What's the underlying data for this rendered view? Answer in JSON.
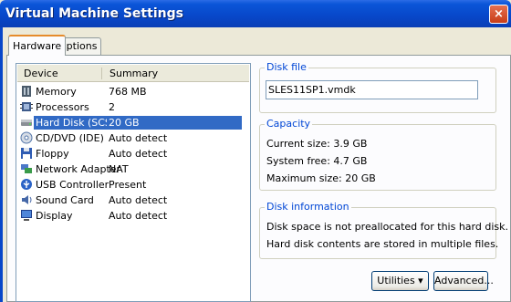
{
  "window": {
    "title": "Virtual Machine Settings",
    "close_glyph": "×"
  },
  "tabs": [
    {
      "label": "Hardware"
    },
    {
      "label": "Options"
    }
  ],
  "device_list": {
    "columns": {
      "device": "Device",
      "summary": "Summary"
    },
    "rows": [
      {
        "name": "Memory",
        "summary": "768 MB",
        "icon": "memory-icon"
      },
      {
        "name": "Processors",
        "summary": "2",
        "icon": "processor-icon"
      },
      {
        "name": "Hard Disk (SCSI)",
        "summary": "20 GB",
        "icon": "hard-disk-icon",
        "selected": true
      },
      {
        "name": "CD/DVD (IDE)",
        "summary": "Auto detect",
        "icon": "cd-dvd-icon"
      },
      {
        "name": "Floppy",
        "summary": "Auto detect",
        "icon": "floppy-icon"
      },
      {
        "name": "Network Adapter",
        "summary": "NAT",
        "icon": "network-adapter-icon"
      },
      {
        "name": "USB Controller",
        "summary": "Present",
        "icon": "usb-icon"
      },
      {
        "name": "Sound Card",
        "summary": "Auto detect",
        "icon": "sound-card-icon"
      },
      {
        "name": "Display",
        "summary": "Auto detect",
        "icon": "display-icon"
      }
    ]
  },
  "disk_file": {
    "label": "Disk file",
    "value": "SLES11SP1.vmdk"
  },
  "capacity": {
    "label": "Capacity",
    "current_size": "Current size:  3.9 GB",
    "system_free": "System free:  4.7 GB",
    "maximum_size": "Maximum size:  20 GB"
  },
  "disk_information": {
    "label": "Disk information",
    "line1": "Disk space is not preallocated for this hard disk.",
    "line2": "Hard disk contents are stored in multiple files."
  },
  "buttons": {
    "utilities": "Utilities  ▾",
    "advanced": "Advanced..."
  },
  "colors": {
    "title_bar": "#0847c9",
    "selection": "#316ac5",
    "group_label": "#0046d5"
  }
}
